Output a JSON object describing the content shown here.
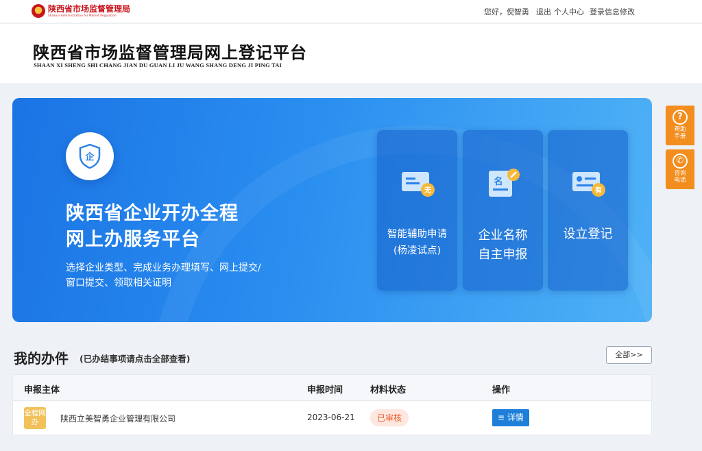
{
  "topbar": {
    "logo_cn": "陕西省市场监督管理局",
    "logo_en": "Shaanxi Administration for Market Regulation",
    "greeting": "您好，倪智勇",
    "logout": "退出",
    "personal_center": "个人中心",
    "edit_login": "登录信息修改"
  },
  "header": {
    "title": "陕西省市场监督管理局网上登记平台",
    "subtitle": "SHAAN XI SHENG SHI CHANG JIAN DU GUAN LI JU WANG SHANG DENG JI PING TAI"
  },
  "banner": {
    "title_line1": "陕西省企业开办全程",
    "title_line2": "网上办服务平台",
    "desc": "选择企业类型、完成业务办理填写、网上提交/窗口提交、领取相关证明",
    "badge_char": "企",
    "services": [
      {
        "line1": "智能辅助申请",
        "line2": "(杨凌试点)",
        "icon_char": "无"
      },
      {
        "line1": "企业名称",
        "line2": "自主申报",
        "icon_char": "名"
      },
      {
        "line1": "设立登记",
        "line2": "",
        "icon_char": "有"
      }
    ]
  },
  "side": {
    "help": "帮助手册",
    "phone": "咨询电话"
  },
  "my_affairs": {
    "title": "我的办件",
    "note": "(已办结事项请点击全部查看)",
    "all_button": "全部>>",
    "columns": [
      "申报主体",
      "申报时间",
      "材料状态",
      "操作"
    ],
    "rows": [
      {
        "tag": "全程网办",
        "company": "陕西立美智勇企业管理有限公司",
        "date": "2023-06-21",
        "status": "已审核",
        "action": "详情"
      }
    ]
  },
  "colors": {
    "brand_red": "#c8161d",
    "banner_blue": "#1b74e4",
    "side_orange": "#f28d1e",
    "status_text": "#f05a28",
    "detail_blue": "#1e7fd9"
  }
}
